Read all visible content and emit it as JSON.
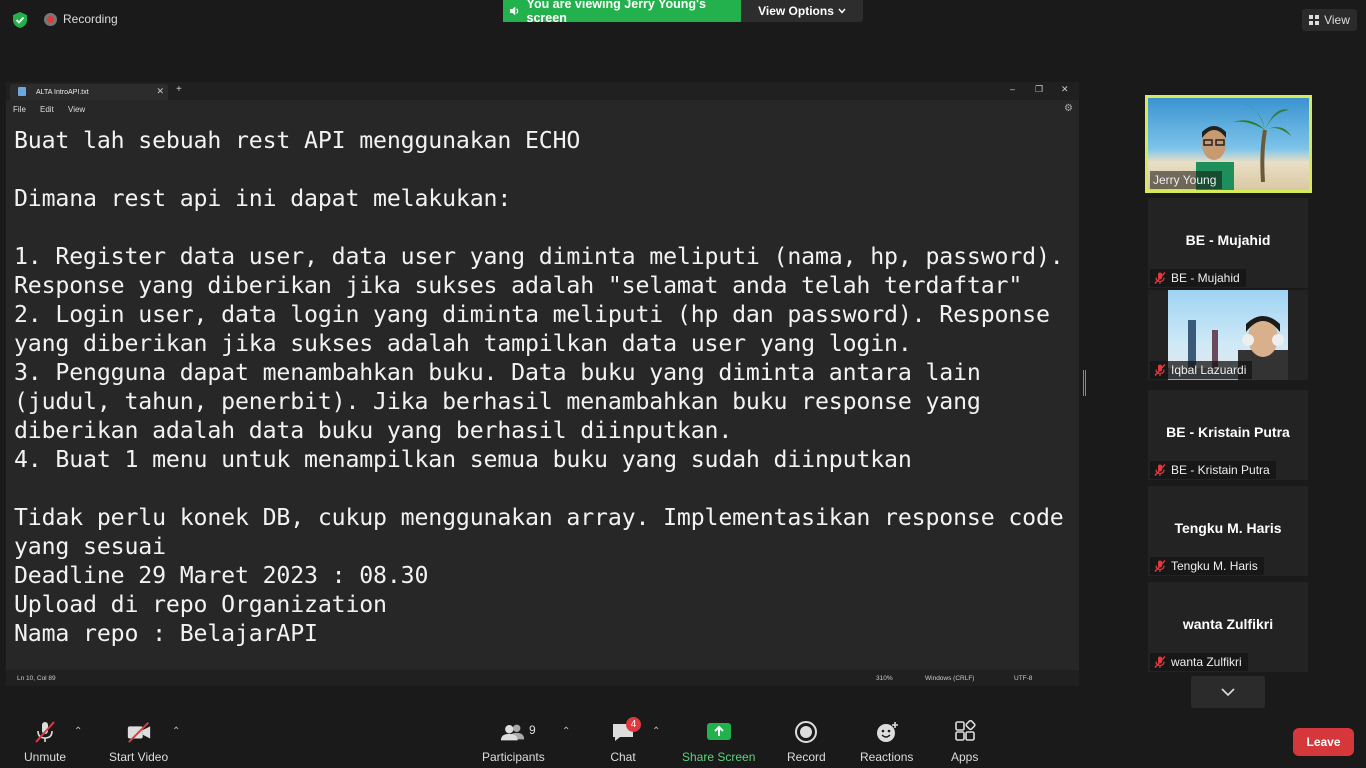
{
  "topbar": {
    "recording_label": "Recording",
    "viewing_banner": "You are viewing Jerry Young's screen",
    "view_options_label": "View Options",
    "view_label": "View"
  },
  "notepad": {
    "tab_title": "ALTA IntroAPI.txt",
    "menu": [
      "File",
      "Edit",
      "View"
    ],
    "lines": [
      "Buat lah sebuah rest API menggunakan ECHO",
      "",
      "Dimana rest api ini dapat melakukan:",
      "",
      "1. Register data user, data user yang diminta meliputi (nama, hp, password).",
      "Response yang diberikan jika sukses adalah \"selamat anda telah terdaftar\"",
      "2. Login user, data login yang diminta meliputi (hp dan password). Response",
      "yang diberikan jika sukses adalah tampilkan data user yang login.",
      "3. Pengguna dapat menambahkan buku. Data buku yang diminta antara lain",
      "(judul, tahun, penerbit). Jika berhasil menambahkan buku response yang",
      "diberikan adalah data buku yang berhasil diinputkan.",
      "4. Buat 1 menu untuk menampilkan semua buku yang sudah diinputkan",
      "",
      "Tidak perlu konek DB, cukup menggunakan array. Implementasikan response code",
      "yang sesuai",
      "Deadline 29 Maret 2023 : 08.30",
      "Upload di repo Organization",
      "Nama repo : BelajarAPI"
    ],
    "status": {
      "position": "Ln 10, Col 89",
      "zoom": "310%",
      "line_ending": "Windows (CRLF)",
      "encoding": "UTF-8"
    }
  },
  "participants": [
    {
      "name": "Jerry Young",
      "video": true,
      "muted": false,
      "active": true
    },
    {
      "name": "BE - Mujahid",
      "video": false,
      "muted": true
    },
    {
      "name": "Iqbal Lazuardi",
      "video": true,
      "muted": true
    },
    {
      "name": "BE - Kristain Putra",
      "video": false,
      "muted": true
    },
    {
      "name": "Tengku M. Haris",
      "video": false,
      "muted": true
    },
    {
      "name": "wanta Zulfikri",
      "video": false,
      "muted": true
    }
  ],
  "toolbar": {
    "unmute": "Unmute",
    "start_video": "Start Video",
    "participants": "Participants",
    "participants_count": "9",
    "chat": "Chat",
    "chat_badge": "4",
    "share_screen": "Share Screen",
    "record": "Record",
    "reactions": "Reactions",
    "apps": "Apps",
    "leave": "Leave"
  },
  "colors": {
    "share_green": "#22b14c",
    "active_speaker_border": "#d7ea5a",
    "leave_red": "#d6373a",
    "muted_red": "#e0393e"
  }
}
